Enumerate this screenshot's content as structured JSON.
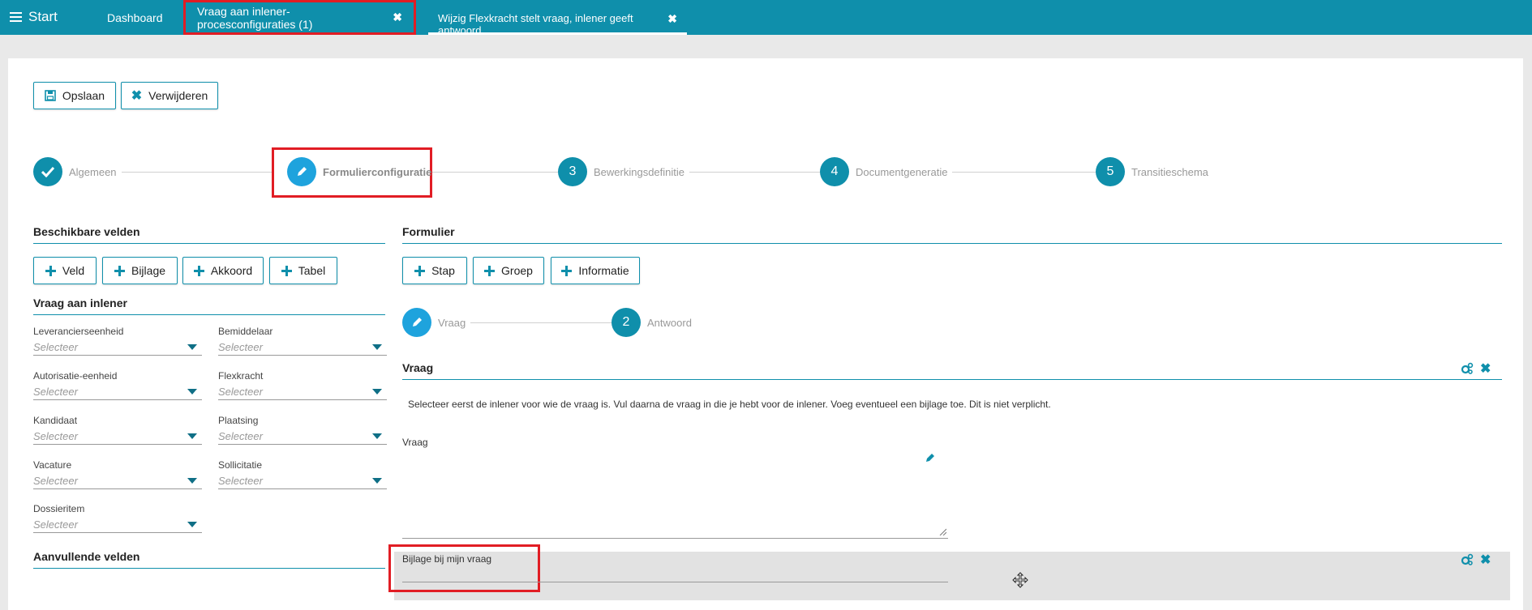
{
  "topbar": {
    "start_label": "Start",
    "tabs": [
      {
        "label": "Dashboard"
      },
      {
        "label": "Vraag aan inlener-procesconfiguraties (1)"
      },
      {
        "label": "Wijzig Flexkracht stelt vraag, inlener geeft antwoord"
      }
    ]
  },
  "toolbar": {
    "save_label": "Opslaan",
    "delete_label": "Verwijderen"
  },
  "stepper": [
    {
      "number": "",
      "label": "Algemeen",
      "state": "done"
    },
    {
      "number": "",
      "label": "Formulierconfiguratie",
      "state": "active"
    },
    {
      "number": "3",
      "label": "Bewerkingsdefinitie",
      "state": "todo"
    },
    {
      "number": "4",
      "label": "Documentgeneratie",
      "state": "todo"
    },
    {
      "number": "5",
      "label": "Transitieschema",
      "state": "todo"
    }
  ],
  "left": {
    "title": "Beschikbare velden",
    "add_buttons": [
      "Veld",
      "Bijlage",
      "Akkoord",
      "Tabel"
    ],
    "group_title": "Vraag aan inlener",
    "fields": [
      {
        "label": "Leverancierseenheid",
        "value": "Selecteer"
      },
      {
        "label": "Bemiddelaar",
        "value": "Selecteer"
      },
      {
        "label": "Autorisatie-eenheid",
        "value": "Selecteer"
      },
      {
        "label": "Flexkracht",
        "value": "Selecteer"
      },
      {
        "label": "Kandidaat",
        "value": "Selecteer"
      },
      {
        "label": "Plaatsing",
        "value": "Selecteer"
      },
      {
        "label": "Vacature",
        "value": "Selecteer"
      },
      {
        "label": "Sollicitatie",
        "value": "Selecteer"
      },
      {
        "label": "Dossieritem",
        "value": "Selecteer"
      }
    ],
    "extra_title": "Aanvullende velden"
  },
  "right": {
    "title": "Formulier",
    "add_buttons": [
      "Stap",
      "Groep",
      "Informatie"
    ],
    "substeps": [
      {
        "number": "",
        "label": "Vraag",
        "state": "active"
      },
      {
        "number": "2",
        "label": "Antwoord",
        "state": "todo"
      }
    ],
    "group_title": "Vraag",
    "info_text": "Selecteer eerst de inlener voor wie de vraag is. Vul daarna de vraag in die je hebt voor de inlener. Voeg eventueel een bijlage toe. Dit is niet verplicht.",
    "textarea_label": "Vraag",
    "attachment_label": "Bijlage bij mijn vraag"
  },
  "colors": {
    "accent": "#0f8fab",
    "highlight": "#e11d24",
    "active_step": "#1ea3dd"
  }
}
